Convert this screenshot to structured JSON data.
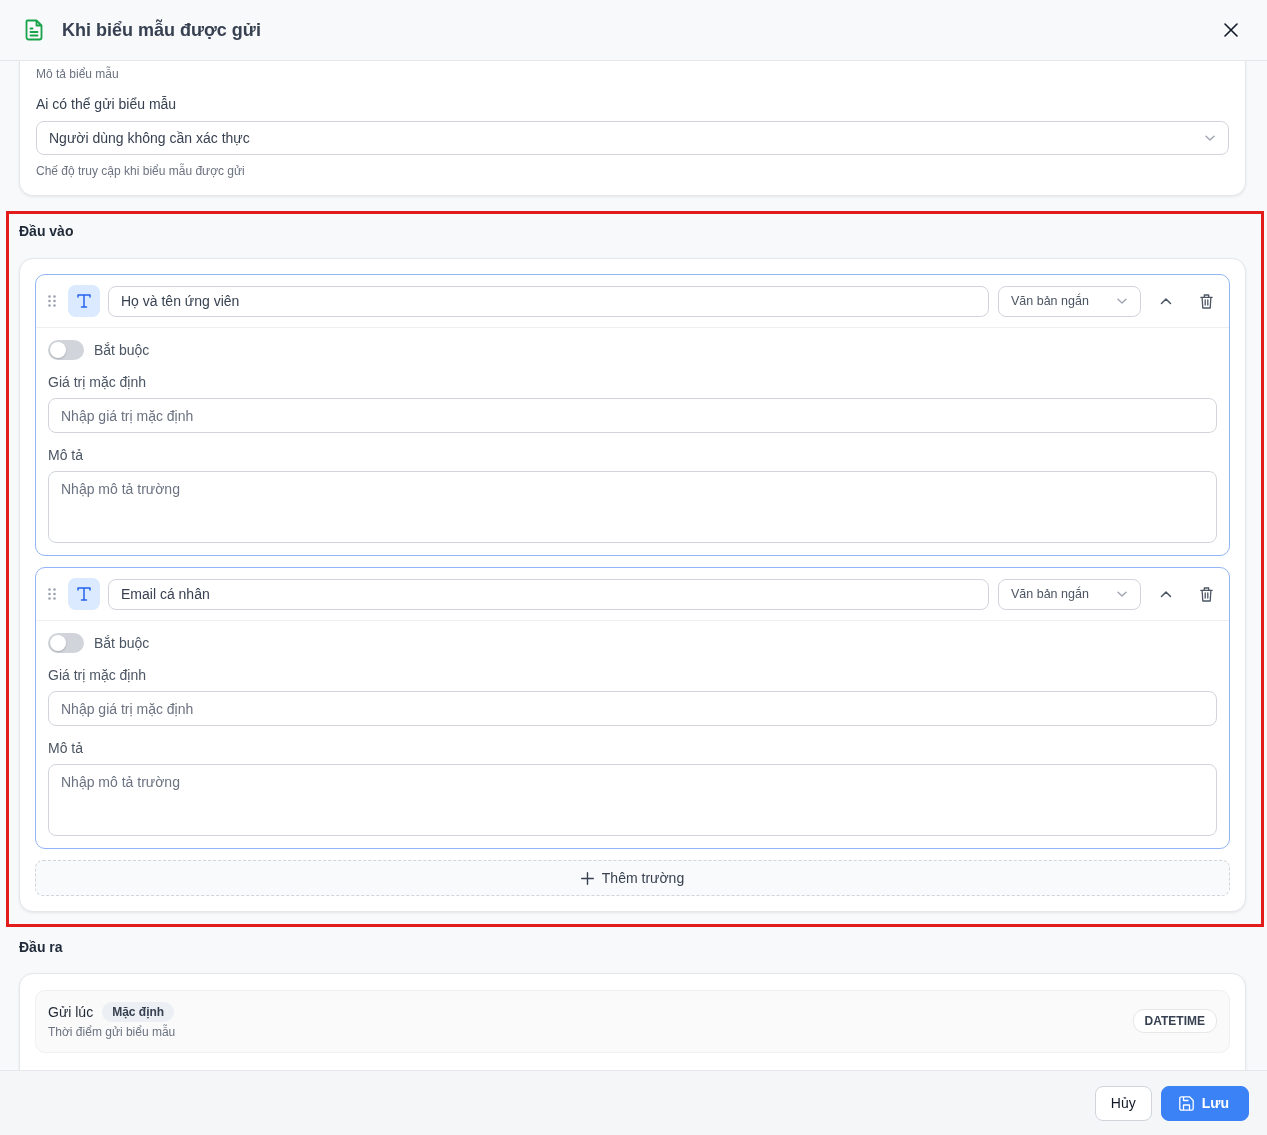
{
  "dialog": {
    "title": "Khi biểu mẫu được gửi"
  },
  "form_settings": {
    "description_hint": "Mô tả biểu mẫu",
    "submitter_label": "Ai có thể gửi biểu mẫu",
    "submitter_value": "Người dùng không cần xác thực",
    "submitter_hint": "Chế độ truy cập khi biểu mẫu được gửi"
  },
  "inputs": {
    "title": "Đầu vào",
    "highlighted": true,
    "fields": [
      {
        "name": "Họ và tên ứng viên",
        "type": "Văn bản ngắn",
        "expanded": true,
        "required": false,
        "required_label": "Bắt buộc",
        "default_label": "Giá trị mặc định",
        "default_placeholder": "Nhập giá trị mặc định",
        "description_label": "Mô tả",
        "description_placeholder": "Nhập mô tả trường"
      },
      {
        "name": "Email cá nhân",
        "type": "Văn bản ngắn",
        "expanded": true,
        "required": false,
        "required_label": "Bắt buộc",
        "default_label": "Giá trị mặc định",
        "default_placeholder": "Nhập giá trị mặc định",
        "description_label": "Mô tả",
        "description_placeholder": "Nhập mô tả trường"
      }
    ],
    "add_button": "Thêm trường"
  },
  "outputs": {
    "title": "Đầu ra",
    "items": [
      {
        "name": "Gửi lúc",
        "badge": "Mặc định",
        "description": "Thời điểm gửi biểu mẫu",
        "type": "DATETIME"
      }
    ]
  },
  "footer": {
    "buttons": [
      {
        "label": "Hủy",
        "kind": "secondary"
      },
      {
        "label": "Lưu",
        "kind": "primary"
      }
    ]
  }
}
